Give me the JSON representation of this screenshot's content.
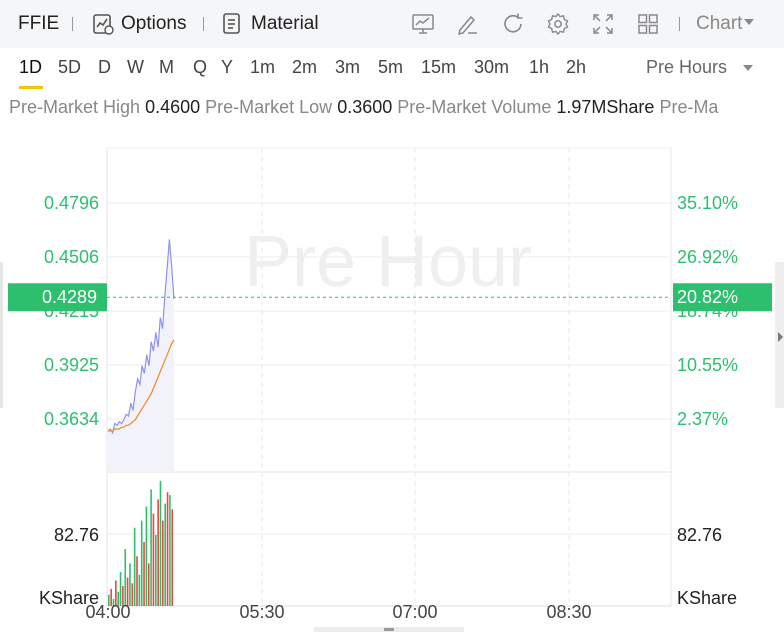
{
  "app": {
    "ticker": "FFIE",
    "options_label": "Options",
    "material_label": "Material",
    "chart_menu_label": "Chart"
  },
  "toolbar_icons": [
    "indicator-icon",
    "draw-icon",
    "refresh-icon",
    "settings-icon",
    "fullscreen-icon",
    "layout-icon"
  ],
  "periods": [
    "1D",
    "5D",
    "D",
    "W",
    "M",
    "Q",
    "Y",
    "1m",
    "2m",
    "3m",
    "5m",
    "15m",
    "30m",
    "1h",
    "2h"
  ],
  "active_period": "1D",
  "session_select": "Pre Hours",
  "stats": {
    "high_label": "Pre-Market High",
    "high_value": "0.4600",
    "low_label": "Pre-Market Low",
    "low_value": "0.3600",
    "volume_label": "Pre-Market Volume",
    "volume_value": "1.97MShare",
    "truncated_label": "Pre-Ma"
  },
  "colors": {
    "up": "#2dbf6e",
    "down": "#e8483f",
    "price_line": "#8f93e8",
    "avg_line": "#f08a24",
    "current_badge": "#2dbf6e"
  },
  "chart_data": {
    "type": "line",
    "watermark": "Pre Hour",
    "price_axis": {
      "ticks": [
        "0.4796",
        "0.4506",
        "0.4215",
        "0.3925",
        "0.3634"
      ],
      "values": [
        0.4796,
        0.4506,
        0.4215,
        0.3925,
        0.3634
      ]
    },
    "percent_axis": {
      "ticks": [
        "35.10%",
        "26.92%",
        "18.74%",
        "10.55%",
        "2.37%"
      ]
    },
    "current_price": "0.4289",
    "current_change": "20.82%",
    "x_ticks": [
      "04:00",
      "05:30",
      "07:00",
      "08:30"
    ],
    "volume_axis": {
      "ticks": [
        "82.76",
        "KShare"
      ],
      "right_ticks": [
        "82.76",
        "KShare"
      ],
      "max": 82.76
    },
    "price_series": [
      0.357,
      0.358,
      0.356,
      0.361,
      0.36,
      0.362,
      0.361,
      0.363,
      0.366,
      0.365,
      0.372,
      0.368,
      0.378,
      0.385,
      0.382,
      0.392,
      0.388,
      0.398,
      0.392,
      0.405,
      0.4,
      0.41,
      0.402,
      0.418,
      0.412,
      0.43,
      0.445,
      0.46,
      0.445,
      0.428
    ],
    "avg_series": [
      0.357,
      0.357,
      0.357,
      0.358,
      0.358,
      0.358,
      0.359,
      0.359,
      0.36,
      0.36,
      0.361,
      0.362,
      0.363,
      0.365,
      0.367,
      0.369,
      0.371,
      0.373,
      0.375,
      0.377,
      0.38,
      0.383,
      0.386,
      0.389,
      0.392,
      0.395,
      0.398,
      0.401,
      0.404,
      0.406
    ],
    "volume_series": [
      {
        "v": 8,
        "up": true
      },
      {
        "v": 12,
        "up": false
      },
      {
        "v": 5,
        "up": true
      },
      {
        "v": 18,
        "up": false
      },
      {
        "v": 10,
        "up": true
      },
      {
        "v": 24,
        "up": true
      },
      {
        "v": 14,
        "up": false
      },
      {
        "v": 40,
        "up": true
      },
      {
        "v": 20,
        "up": false
      },
      {
        "v": 30,
        "up": true
      },
      {
        "v": 16,
        "up": false
      },
      {
        "v": 55,
        "up": true
      },
      {
        "v": 35,
        "up": false
      },
      {
        "v": 22,
        "up": true
      },
      {
        "v": 60,
        "up": true
      },
      {
        "v": 45,
        "up": false
      },
      {
        "v": 70,
        "up": true
      },
      {
        "v": 30,
        "up": false
      },
      {
        "v": 82,
        "up": true
      },
      {
        "v": 65,
        "up": false
      },
      {
        "v": 50,
        "up": true
      },
      {
        "v": 75,
        "up": false
      },
      {
        "v": 88,
        "up": true
      },
      {
        "v": 60,
        "up": false
      },
      {
        "v": 72,
        "up": true
      },
      {
        "v": 80,
        "up": false
      },
      {
        "v": 78,
        "up": true
      },
      {
        "v": 68,
        "up": false
      }
    ]
  }
}
